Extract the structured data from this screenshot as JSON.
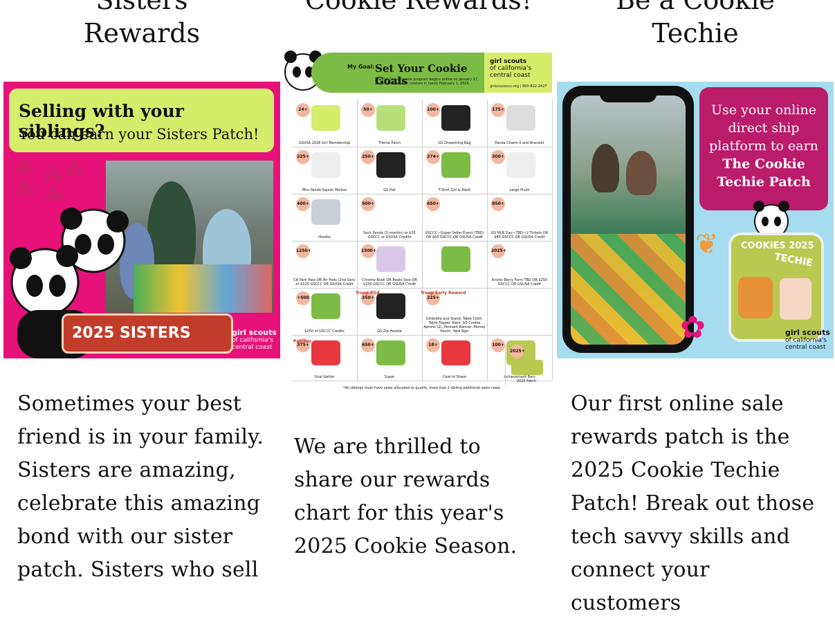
{
  "columns": [
    {
      "title_lines": [
        "Sisters",
        "Rewards"
      ],
      "card": {
        "banner_heading": "Selling with your siblings?",
        "banner_sub": "You can earn your Sisters Patch!",
        "patch_text": "2025 SISTERS",
        "logo_line1": "girl scouts",
        "logo_line2": "of california's",
        "logo_line3": "central coast"
      },
      "text": "Sometimes your best friend is in your family. Sisters are amazing, celebrate this amazing bond with our sister patch. Sisters who sell"
    },
    {
      "title_lines": [
        "Cookie Rewards!"
      ],
      "chart": {
        "my_goal_label": "My Goal:",
        "title": "Set Your Cookie Goals",
        "subtitle": "The Girl Scout Cookie program begins online on January 17, and in-person (with cookies in hand) February 1, 2025.",
        "logo_line1": "girl scouts",
        "logo_line2": "of california's",
        "logo_line3": "central coast",
        "logo_url": "girlscoutsccc.org | 800-822-2427",
        "rows": [
          [
            {
              "pk": "24+",
              "name": "GSUSA 2026 Girl Membership",
              "color": "#d6ec6b"
            },
            {
              "pk": "50+",
              "name": "Theme Patch",
              "color": "#b7e07a"
            },
            {
              "pk": "100+",
              "name": "GS Drawstring Bag",
              "color": "#222"
            },
            {
              "pk": "175+",
              "name": "Panda Charm II and Bracelet",
              "color": "#ddd"
            }
          ],
          [
            {
              "pk": "225+",
              "name": "Mini Panda Squish Mellow",
              "color": "#eee"
            },
            {
              "pk": "250+",
              "name": "GS Hat",
              "color": "#222"
            },
            {
              "pk": "274+",
              "name": "T-Shirt Girl & Adult",
              "color": "#7cbc45"
            },
            {
              "pk": "300+",
              "name": "Large Plush",
              "color": "#eee"
            }
          ],
          [
            {
              "pk": "400+",
              "name": "Hoodie",
              "color": "#c9cfd6"
            },
            {
              "pk": "500+",
              "name": "Sock Panda (3 months) or $35 GSCCC or GSUSA Credits",
              "color": "#fff"
            },
            {
              "pk": "650+",
              "name": "GSCCC—Super Seller Event (TBD) OR $65 GSCCC OR GSUSA Credit",
              "color": "#fff"
            },
            {
              "pk": "850+",
              "name": "GS MLB Day—TBD—2 Tickets OR $85 GSCCC OR GSUSA Credit",
              "color": "#fff"
            }
          ],
          [
            {
              "pk": "1250+",
              "name": "CA Park Pass OR Air Pods (2nd Gen) or $125 GSCCC OR GSUSA Credit",
              "color": "#fff"
            },
            {
              "pk": "1500+",
              "name": "Chrome Book OR Beats Solo OR $150 GSCCC OR GSUSA Credit",
              "color": "#d8c8e8"
            },
            {
              "pk": "",
              "name": "",
              "color": "#7cbc45"
            },
            {
              "pk": "2025+",
              "name": "Knotts Berry Farm TBD OR $250 GSCCC OR GSUSA Credit",
              "color": "#fff"
            }
          ],
          [
            {
              "pk": "+500",
              "name": "$250 of GSCCC Credits",
              "color": "#7cbc45"
            },
            {
              "pk": "350+",
              "name": "GS Zip Hoodie",
              "color": "#222"
            },
            {
              "pk": "225+",
              "name": "Umbrella and Stand, Table Cloth, Table Topper Stars, GS Cookie Aprons (2), Pennant Banner, Money Pouch, Yard Sign",
              "color": "#fff"
            },
            {
              "pk": "",
              "name": "",
              "color": "#fff"
            }
          ],
          [
            {
              "pk": "375+",
              "name": "Goal Getter",
              "color": "#e8383d"
            },
            {
              "pk": "650+",
              "name": "Super",
              "color": "#7cbc45"
            },
            {
              "pk": "18+",
              "name": "Care to Share",
              "color": "#e8383d"
            },
            {
              "pk": "100+",
              "name": "Achievement Bars",
              "color": "#b9c952"
            }
          ]
        ],
        "section_labels": {
          "troop_pga": "Troop PGA",
          "troop_early": "Troop Early Reward",
          "patches": "Patches"
        },
        "extra_last": {
          "pk": "2025+",
          "name": "2025 Patch"
        },
        "footnote": "*All siblings must have sales allocated to qualify, more that 2 sibling additional sales need."
      },
      "text": "We are thrilled to share our rewards chart for this year's 2025 Cookie Season."
    },
    {
      "title_lines": [
        "Be a Cookie",
        "Techie"
      ],
      "card": {
        "box_l1": "Use your online",
        "box_l2": "direct ship",
        "box_l3": "platform to earn",
        "box_b1": "The Cookie",
        "box_b2": "Techie Patch",
        "patch_l1": "COOKIES 2025",
        "patch_l2": "TECHIE",
        "logo_line1": "girl scouts",
        "logo_line2": "of california's",
        "logo_line3": "central coast"
      },
      "text": "Our first online sale rewards patch is the 2025 Cookie Techie Patch! Break out those tech savvy skills and connect your customers"
    }
  ]
}
